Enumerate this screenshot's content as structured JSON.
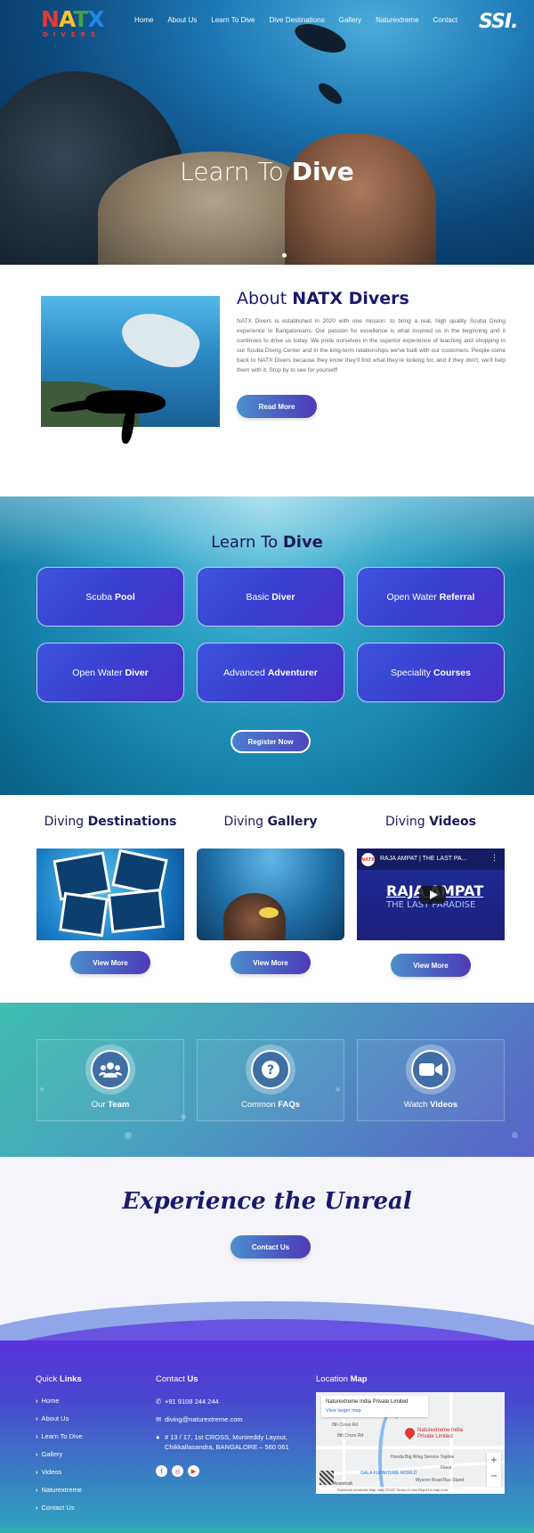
{
  "nav": {
    "logo_text": [
      "N",
      "A",
      "T",
      "X"
    ],
    "logo_sub": "DIVERS",
    "items": [
      "Home",
      "About Us",
      "Learn To Dive",
      "Dive Destinations",
      "Gallery",
      "Naturextreme",
      "Contact"
    ],
    "partner_logo": "SSI."
  },
  "hero": {
    "title_light": "Learn To",
    "title_bold": "Dive"
  },
  "about": {
    "title_light": "About",
    "title_bold": "NATX Divers",
    "text": "NATX Divers is established in 2020 with one mission: to bring a real, high quality Scuba Diving experience to Bangaloreans. Our passion for excellence is what inspired us in the beginning and it continues to drive us today. We pride ourselves in the superior experience of teaching and shopping in our Scuba Diving Center and in the long-term relationships we've built with our customers. People come back to NATX Divers because they know they'll find what they're looking for, and if they don't, we'll help them with it. Stop by to see for yourself!",
    "button": "Read More"
  },
  "learn": {
    "title_light": "Learn To",
    "title_bold": "Dive",
    "courses": [
      {
        "light": "Scuba",
        "bold": "Pool"
      },
      {
        "light": "Basic",
        "bold": "Diver"
      },
      {
        "light": "Open Water",
        "bold": "Referral"
      },
      {
        "light": "Open Water",
        "bold": "Diver"
      },
      {
        "light": "Advanced",
        "bold": "Adventurer"
      },
      {
        "light": "Speciality",
        "bold": "Courses"
      }
    ],
    "button": "Register Now"
  },
  "diving": [
    {
      "light": "Diving",
      "bold": "Destinations",
      "button": "View More"
    },
    {
      "light": "Diving",
      "bold": "Gallery",
      "button": "View More"
    },
    {
      "light": "Diving",
      "bold": "Videos",
      "button": "View More"
    }
  ],
  "video": {
    "channel": "NATX",
    "name": "RAJA AMPAT | THE LAST PA...",
    "big": "RAJA AMPAT",
    "sub": "THE LAST PARADISE"
  },
  "team": [
    {
      "light": "Our",
      "bold": "Team",
      "icon": "users-icon"
    },
    {
      "light": "Common",
      "bold": "FAQs",
      "icon": "question-icon"
    },
    {
      "light": "Watch",
      "bold": "Videos",
      "icon": "video-camera-icon"
    }
  ],
  "experience": {
    "title": "Experience the Unreal",
    "button": "Contact Us"
  },
  "footer": {
    "quick_light": "Quick",
    "quick_bold": "Links",
    "links": [
      "Home",
      "About Us",
      "Learn To Dive",
      "Gallery",
      "Videos",
      "Naturextreme",
      "Contact Us"
    ],
    "contact_light": "Contact",
    "contact_bold": "Us",
    "phone": "+91 9108 244 244",
    "email": "diving@naturextreme.com",
    "address_line1": "# 13 / 17, 1st CROSS, Munireddy Layout,",
    "address_line2": "Chikkallasandra, BANGALORE – 560 061",
    "map_light": "Location",
    "map_bold": "Map",
    "map_name": "Naturextreme India Private Limited",
    "map_link": "View larger map",
    "map_pin": "Naturextreme India Private Limited",
    "map_labels": [
      "8th Cross Rd",
      "8th Cross Rd",
      "GALA FURNITURE WORLD",
      "Honda Big Wing Service Topline",
      "Flava",
      "Mysore Road Bus Stand",
      "Avalahalli"
    ],
    "map_attrib": "Keyboard shortcuts   Map data ©2022   Terms of Use   Report a map error"
  }
}
